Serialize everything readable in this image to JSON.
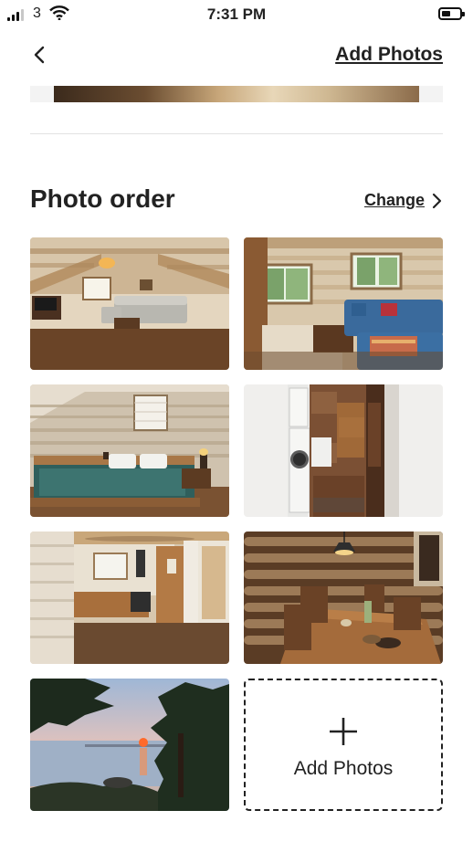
{
  "status_bar": {
    "carrier": "3",
    "time": "7:31 PM"
  },
  "header": {
    "back_icon": "chevron-left-icon",
    "add_photos_link": "Add Photos"
  },
  "section": {
    "title": "Photo order",
    "change_label": "Change"
  },
  "photos": [
    {
      "name": "attic-living-room-photo"
    },
    {
      "name": "living-room-sofa-photo"
    },
    {
      "name": "bedroom-photo"
    },
    {
      "name": "bathroom-laundry-photo"
    },
    {
      "name": "kitchen-photo"
    },
    {
      "name": "dining-room-photo"
    },
    {
      "name": "lake-sunset-photo"
    }
  ],
  "add_tile": {
    "label": "Add Photos",
    "icon": "plus-icon"
  }
}
